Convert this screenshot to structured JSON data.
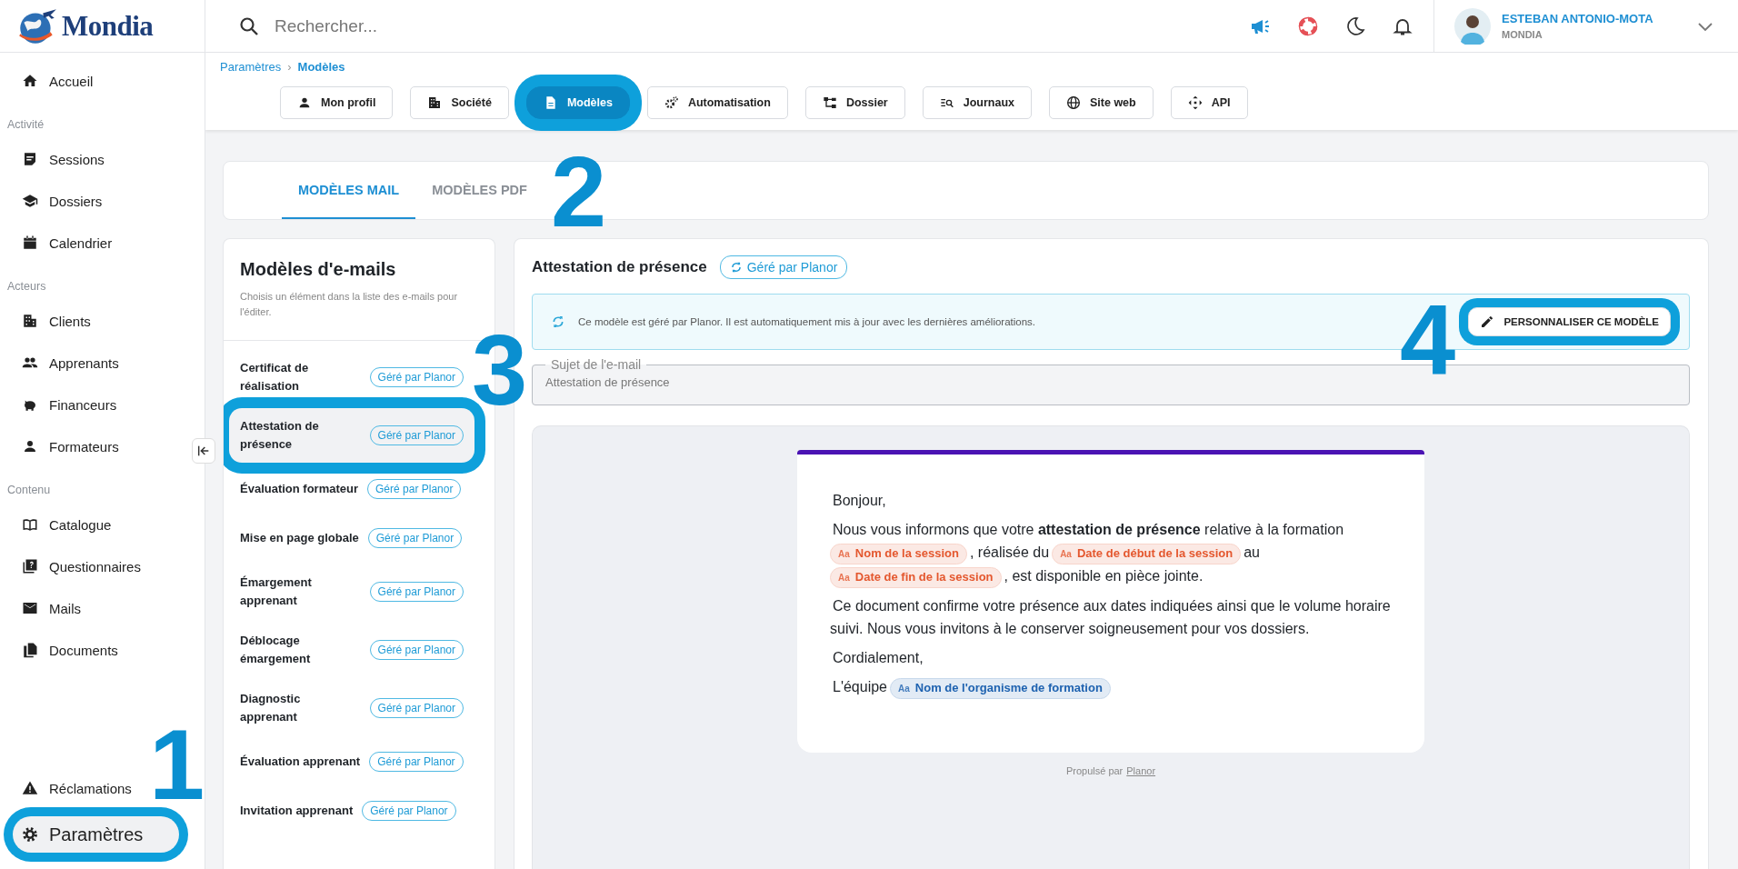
{
  "logo": {
    "text": "Mondia"
  },
  "sidebar": {
    "sections": [
      {
        "items": [
          {
            "label": "Accueil",
            "selected": false,
            "highlighted": false
          }
        ]
      },
      {
        "title": "Activité",
        "items": [
          {
            "label": "Sessions",
            "selected": false,
            "highlighted": false
          },
          {
            "label": "Dossiers",
            "selected": false,
            "highlighted": false
          },
          {
            "label": "Calendrier",
            "selected": false,
            "highlighted": false
          }
        ]
      },
      {
        "title": "Acteurs",
        "items": [
          {
            "label": "Clients",
            "selected": false,
            "highlighted": false
          },
          {
            "label": "Apprenants",
            "selected": false,
            "highlighted": false
          },
          {
            "label": "Financeurs",
            "selected": false,
            "highlighted": false
          },
          {
            "label": "Formateurs",
            "selected": false,
            "highlighted": false
          }
        ]
      },
      {
        "title": "Contenu",
        "items": [
          {
            "label": "Catalogue",
            "selected": false,
            "highlighted": false
          },
          {
            "label": "Questionnaires",
            "selected": false,
            "highlighted": false
          },
          {
            "label": "Mails",
            "selected": false,
            "highlighted": false
          },
          {
            "label": "Documents",
            "selected": false,
            "highlighted": false
          }
        ]
      }
    ],
    "footer_items": [
      {
        "label": "Réclamations",
        "selected": false,
        "highlighted": false
      },
      {
        "label": "Paramètres",
        "selected": true,
        "highlighted": true
      }
    ]
  },
  "search": {
    "placeholder": "Rechercher..."
  },
  "user": {
    "name": "ESTEBAN ANTONIO-MOTA",
    "company": "MONDIA"
  },
  "breadcrumb": {
    "items": [
      "Paramètres",
      "Modèles"
    ],
    "separator": "›"
  },
  "settings_tabs": [
    {
      "label": "Mon profil",
      "selected": false,
      "highlighted": false
    },
    {
      "label": "Société",
      "selected": false,
      "highlighted": false
    },
    {
      "label": "Modèles",
      "selected": true,
      "highlighted": true
    },
    {
      "label": "Automatisation",
      "selected": false,
      "highlighted": false
    },
    {
      "label": "Dossier",
      "selected": false,
      "highlighted": false
    },
    {
      "label": "Journaux",
      "selected": false,
      "highlighted": false
    },
    {
      "label": "Site web",
      "selected": false,
      "highlighted": false
    },
    {
      "label": "API",
      "selected": false,
      "highlighted": false
    }
  ],
  "template_tabs": [
    {
      "label": "MODÈLES MAIL",
      "selected": true
    },
    {
      "label": "MODÈLES PDF",
      "selected": false
    }
  ],
  "templates": {
    "title": "Modèles d'e-mails",
    "subtitle": "Choisis un élément dans la liste des e-mails pour l'éditer.",
    "items": [
      {
        "name": "Certificat de réalisation",
        "badge": "Géré par Planor",
        "selected": false,
        "highlighted": false
      },
      {
        "name": "Attestation de présence",
        "badge": "Géré par Planor",
        "selected": true,
        "highlighted": true
      },
      {
        "name": "Évaluation formateur",
        "badge": "Géré par Planor",
        "selected": false,
        "highlighted": false
      },
      {
        "name": "Mise en page globale",
        "badge": "Géré par Planor",
        "selected": false,
        "highlighted": false
      },
      {
        "name": "Émargement apprenant",
        "badge": "Géré par Planor",
        "selected": false,
        "highlighted": false
      },
      {
        "name": "Déblocage émargement",
        "badge": "Géré par Planor",
        "selected": false,
        "highlighted": false
      },
      {
        "name": "Diagnostic apprenant",
        "badge": "Géré par Planor",
        "selected": false,
        "highlighted": false
      },
      {
        "name": "Évaluation apprenant",
        "badge": "Géré par Planor",
        "selected": false,
        "highlighted": false
      },
      {
        "name": "Invitation apprenant",
        "badge": "Géré par Planor",
        "selected": false,
        "highlighted": false
      }
    ]
  },
  "editor": {
    "title": "Attestation de présence",
    "badge": "Géré par Planor",
    "notice": "Ce modèle est géré par Planor. Il est automatiquement mis à jour avec les dernières améliorations.",
    "customize_button": {
      "label": "PERSONNALISER CE MODÈLE",
      "highlighted": true
    },
    "subject": {
      "label": "Sujet de l'e-mail",
      "value": "Attestation de présence"
    }
  },
  "email": {
    "paragraphs": [
      {
        "parts": [
          {
            "kind": "text",
            "text": "Bonjour,"
          }
        ]
      },
      {
        "parts": [
          {
            "kind": "text",
            "text": "Nous vous informons que votre **attestation de présence** relative à la formation"
          },
          {
            "kind": "variable",
            "icon": "Aa",
            "text": "Nom de la session",
            "color": "#e4572e"
          },
          {
            "kind": "text",
            "text": ", réalisée du"
          },
          {
            "kind": "variable",
            "icon": "Aa",
            "text": "Date de début de la session",
            "color": "#e4572e"
          },
          {
            "kind": "text",
            "text": "au"
          },
          {
            "kind": "variable",
            "icon": "Aa",
            "text": "Date de fin de la session",
            "color": "#e4572e"
          },
          {
            "kind": "text",
            "text": ", est disponible en pièce jointe."
          }
        ]
      },
      {
        "parts": [
          {
            "kind": "text",
            "text": "Ce document confirme votre présence aux dates indiquées ainsi que le volume horaire suivi. Nous vous invitons à le conserver soigneusement pour vos dossiers."
          }
        ]
      },
      {
        "parts": [
          {
            "kind": "text",
            "text": "Cordialement,"
          }
        ]
      },
      {
        "parts": [
          {
            "kind": "text",
            "text": "L'équipe"
          },
          {
            "kind": "variable",
            "icon": "Aa",
            "text": "Nom de l'organisme de formation",
            "color": "#1e62b0"
          }
        ]
      }
    ],
    "footer": "Propulsé par",
    "footer_link": "Planor"
  },
  "annotations": [
    {
      "label": "1"
    },
    {
      "label": "2"
    },
    {
      "label": "3"
    },
    {
      "label": "4"
    }
  ]
}
